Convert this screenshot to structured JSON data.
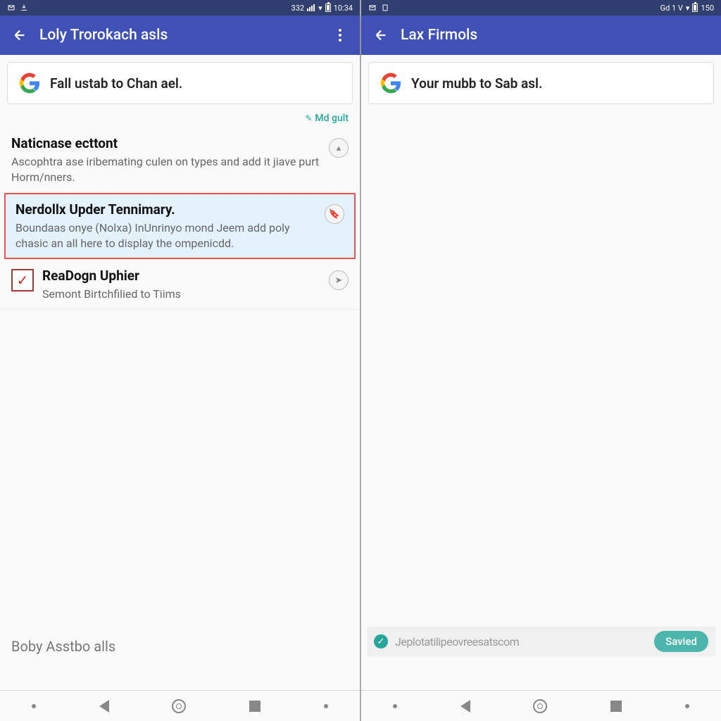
{
  "left": {
    "status": {
      "net": "332",
      "time": "10:34"
    },
    "appbar": {
      "title": "Loly Trorokach asls"
    },
    "card": {
      "text": "Fall ustab to Chan ael."
    },
    "meta_link": "Md gult",
    "items": [
      {
        "title": "Naticnase ecttont",
        "desc": "Ascophtra ase iribemating culen on types and add it jiave purt Horm/nners.",
        "badge": "▴",
        "highlighted": false,
        "has_checkbox": false
      },
      {
        "title": "Nerdollx Upder Tennimary.",
        "desc": "Boundaas onye (Nolxa) InUnrinyo mond Jeem add poly chasic an all here to display the ompenicdd.",
        "badge": "🔖",
        "highlighted": true,
        "has_checkbox": false
      },
      {
        "title": "ReaDogn Uphier",
        "desc": "Semont Birtchfilied to Tiims",
        "badge": "➤",
        "highlighted": false,
        "has_checkbox": true
      }
    ],
    "footer": "Boby Asstbo alls"
  },
  "right": {
    "status": {
      "net": "Gd 1 V",
      "time": "150"
    },
    "appbar": {
      "title": "Lax Firmols"
    },
    "card": {
      "text": "Your mubb to Sab asl."
    },
    "toast": {
      "text": "Jeplotatilipeovreesatscom",
      "chip": "Savied"
    }
  }
}
